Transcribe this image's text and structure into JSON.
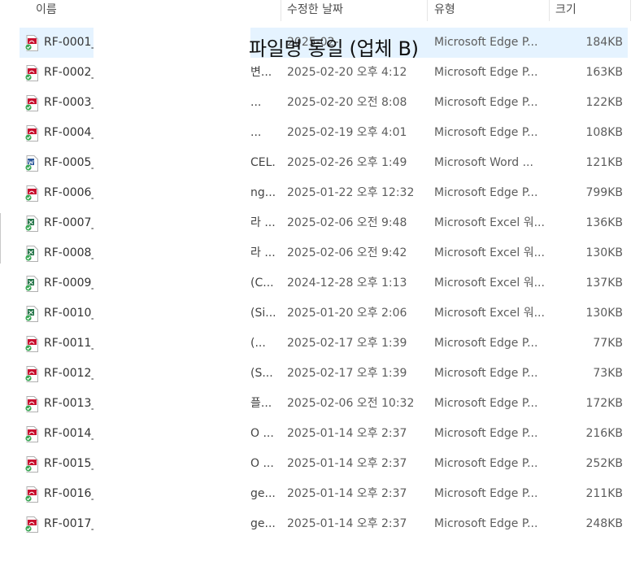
{
  "columns": {
    "name": "이름",
    "modified": "수정한 날짜",
    "type": "유형",
    "size": "크기"
  },
  "overlay": {
    "title": "파일명 통일 (업체 B)"
  },
  "files": [
    {
      "name": "RF-0001_",
      "tail": "",
      "date": "2025-02-",
      "type": "Microsoft Edge P...",
      "size": "184KB",
      "icon": "pdf-icon",
      "selected": true
    },
    {
      "name": "RF-0002_",
      "tail": "변...",
      "date": "2025-02-20 오후 4:12",
      "type": "Microsoft Edge P...",
      "size": "163KB",
      "icon": "pdf-icon"
    },
    {
      "name": "RF-0003_",
      "tail": "...",
      "date": "2025-02-20 오전 8:08",
      "type": "Microsoft Edge P...",
      "size": "122KB",
      "icon": "pdf-icon"
    },
    {
      "name": "RF-0004_",
      "tail": "...",
      "date": "2025-02-19 오후 4:01",
      "type": "Microsoft Edge P...",
      "size": "108KB",
      "icon": "pdf-icon"
    },
    {
      "name": "RF-0005_",
      "tail": "CEL...",
      "date": "2025-02-26 오후 1:49",
      "type": "Microsoft Word ...",
      "size": "121KB",
      "icon": "word-icon"
    },
    {
      "name": "RF-0006_",
      "tail": "ng...",
      "date": "2025-01-22 오후 12:32",
      "type": "Microsoft Edge P...",
      "size": "799KB",
      "icon": "pdf-icon"
    },
    {
      "name": "RF-0007_",
      "tail": "라 ...",
      "date": "2025-02-06 오전 9:48",
      "type": "Microsoft Excel 워...",
      "size": "136KB",
      "icon": "excel-icon"
    },
    {
      "name": "RF-0008_",
      "tail": "라 ...",
      "date": "2025-02-06 오전 9:42",
      "type": "Microsoft Excel 워...",
      "size": "130KB",
      "icon": "excel-icon"
    },
    {
      "name": "RF-0009_",
      "tail": "(C...",
      "date": "2024-12-28 오후 1:13",
      "type": "Microsoft Excel 워...",
      "size": "137KB",
      "icon": "excel-icon"
    },
    {
      "name": "RF-0010_",
      "tail": "(Si...",
      "date": "2025-01-20 오후 2:06",
      "type": "Microsoft Excel 워...",
      "size": "130KB",
      "icon": "excel-icon"
    },
    {
      "name": "RF-0011_",
      "tail": "(...",
      "date": "2025-02-17 오후 1:39",
      "type": "Microsoft Edge P...",
      "size": "77KB",
      "icon": "pdf-icon"
    },
    {
      "name": "RF-0012_",
      "tail": "(S...",
      "date": "2025-02-17 오후 1:39",
      "type": "Microsoft Edge P...",
      "size": "73KB",
      "icon": "pdf-icon"
    },
    {
      "name": "RF-0013_",
      "tail": "플...",
      "date": "2025-02-06 오전 10:32",
      "type": "Microsoft Edge P...",
      "size": "172KB",
      "icon": "pdf-icon"
    },
    {
      "name": "RF-0014_",
      "tail": "O ...",
      "date": "2025-01-14 오후 2:37",
      "type": "Microsoft Edge P...",
      "size": "216KB",
      "icon": "pdf-icon"
    },
    {
      "name": "RF-0015_",
      "tail": "O ...",
      "date": "2025-01-14 오후 2:37",
      "type": "Microsoft Edge P...",
      "size": "252KB",
      "icon": "pdf-icon"
    },
    {
      "name": "RF-0016_",
      "tail": "ge...",
      "date": "2025-01-14 오후 2:37",
      "type": "Microsoft Edge P...",
      "size": "211KB",
      "icon": "pdf-icon"
    },
    {
      "name": "RF-0017_",
      "tail": "ge...",
      "date": "2025-01-14 오후 2:37",
      "type": "Microsoft Edge P...",
      "size": "248KB",
      "icon": "pdf-icon"
    }
  ],
  "colors": {
    "pdf": "#c8102e",
    "word": "#2b579a",
    "excel": "#217346",
    "sync": "#3aa655",
    "selection": "#e5f3ff"
  }
}
